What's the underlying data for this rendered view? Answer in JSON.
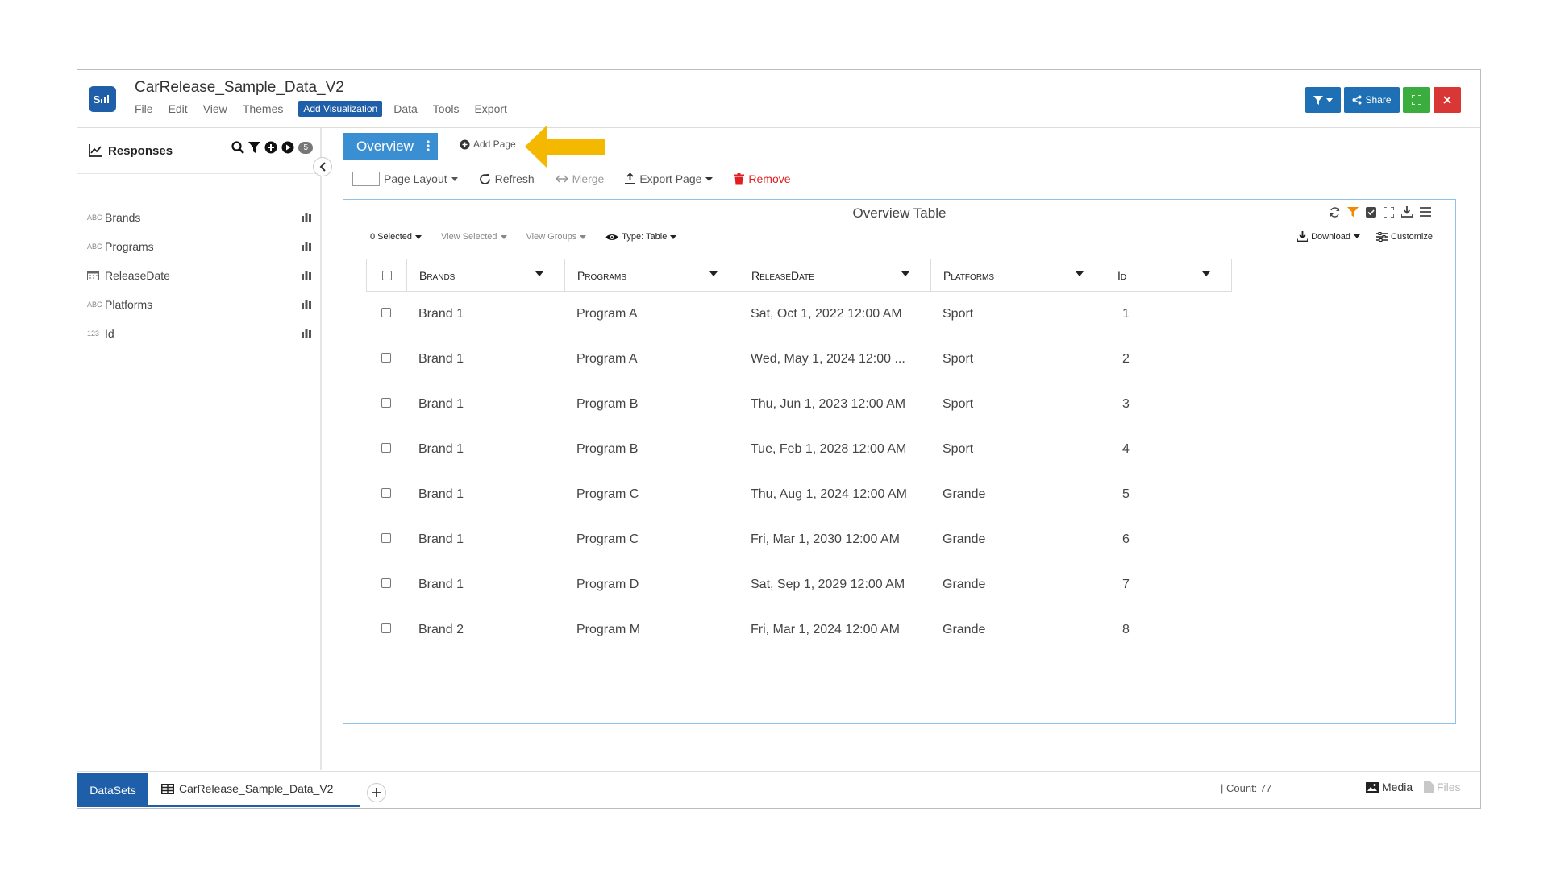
{
  "app": {
    "logo_text": "S",
    "title": "CarRelease_Sample_Data_V2",
    "menu": [
      "File",
      "Edit",
      "View",
      "Themes",
      "Add Visualization",
      "Data",
      "Tools",
      "Export"
    ],
    "share_label": "Share"
  },
  "sidebar": {
    "title": "Responses",
    "count": "5",
    "items": [
      {
        "type": "ABC",
        "label": "Brands"
      },
      {
        "type": "ABC",
        "label": "Programs"
      },
      {
        "type": "date",
        "label": "ReleaseDate"
      },
      {
        "type": "ABC",
        "label": "Platforms"
      },
      {
        "type": "123",
        "label": "Id"
      }
    ]
  },
  "main": {
    "tab_label": "Overview",
    "add_page": "Add Page",
    "toolbar": {
      "page_layout": "Page Layout",
      "refresh": "Refresh",
      "merge": "Merge",
      "export_page": "Export Page",
      "remove": "Remove"
    },
    "panel": {
      "title": "Overview Table",
      "selected": "0 Selected",
      "view_selected": "View Selected",
      "view_groups": "View Groups",
      "type": "Type: Table",
      "download": "Download",
      "customize": "Customize"
    },
    "table": {
      "columns": [
        "Brands",
        "Programs",
        "ReleaseDate",
        "Platforms",
        "Id"
      ],
      "rows": [
        [
          "Brand 1",
          "Program A",
          "Sat, Oct 1, 2022 12:00 AM",
          "Sport",
          "1"
        ],
        [
          "Brand 1",
          "Program A",
          "Wed, May 1, 2024 12:00 ...",
          "Sport",
          "2"
        ],
        [
          "Brand 1",
          "Program B",
          "Thu, Jun 1, 2023 12:00 AM",
          "Sport",
          "3"
        ],
        [
          "Brand 1",
          "Program B",
          "Tue, Feb 1, 2028 12:00 AM",
          "Sport",
          "4"
        ],
        [
          "Brand 1",
          "Program C",
          "Thu, Aug 1, 2024 12:00 AM",
          "Grande",
          "5"
        ],
        [
          "Brand 1",
          "Program C",
          "Fri, Mar 1, 2030 12:00 AM",
          "Grande",
          "6"
        ],
        [
          "Brand 1",
          "Program D",
          "Sat, Sep 1, 2029 12:00 AM",
          "Grande",
          "7"
        ],
        [
          "Brand 2",
          "Program M",
          "Fri, Mar 1, 2024 12:00 AM",
          "Grande",
          "8"
        ]
      ]
    }
  },
  "footer": {
    "datasets": "DataSets",
    "file_tab": "CarRelease_Sample_Data_V2",
    "count": "|    Count: 77",
    "media": "Media",
    "files": "Files"
  },
  "colors": {
    "brand_blue": "#1f5ea8",
    "tab_blue": "#3a8fd3",
    "arrow_yellow": "#f5b800",
    "remove_red": "#e02020",
    "filter_orange": "#f08a00"
  }
}
